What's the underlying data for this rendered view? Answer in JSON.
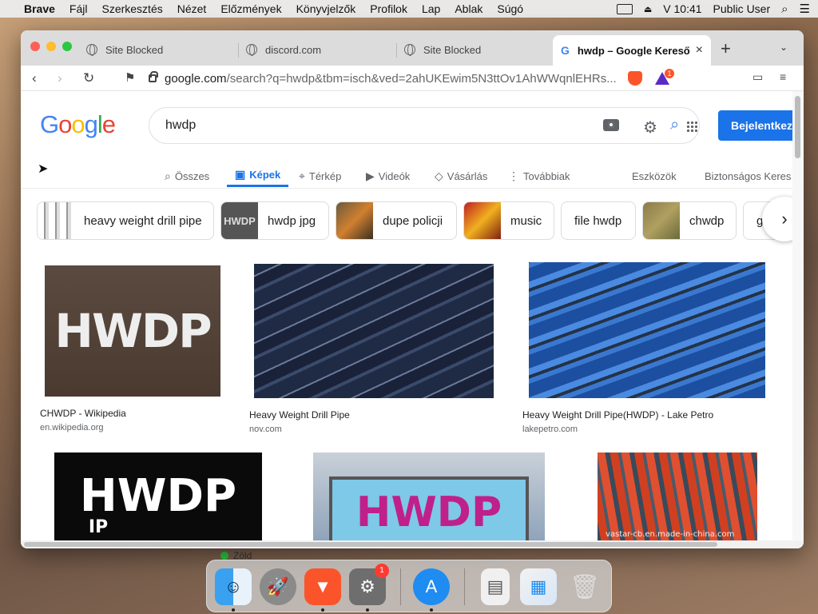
{
  "menubar": {
    "app": "Brave",
    "items": [
      "Fájl",
      "Szerkesztés",
      "Nézet",
      "Előzmények",
      "Könyvjelzők",
      "Profilok",
      "Lap",
      "Ablak",
      "Súgó"
    ],
    "time": "V 10:41",
    "user": "Public User"
  },
  "tabs": [
    {
      "label": "Site Blocked"
    },
    {
      "label": "discord.com"
    },
    {
      "label": "Site Blocked"
    },
    {
      "label": "hwdp – Google Kereső"
    }
  ],
  "address": {
    "host": "google.com",
    "path": "/search?q=hwdp&tbm=isch&ved=2ahUKEwim5N3ttOv1AhWWqnlEHRs..."
  },
  "brave_badge": "1",
  "google": {
    "query": "hwdp",
    "signin": "Bejelentkez",
    "nav": [
      "Összes",
      "Képek",
      "Térkép",
      "Videók",
      "Vásárlás",
      "Továbbiak"
    ],
    "tools": "Eszközök",
    "safe": "Biztonságos Keres"
  },
  "chips": [
    "heavy weight drill pipe",
    "hwdp jpg",
    "dupe policji",
    "music",
    "file hwdp",
    "chwdp",
    "g"
  ],
  "results": [
    {
      "title": "CHWDP - Wikipedia",
      "source": "en.wikipedia.org",
      "text": "HWDP"
    },
    {
      "title": "Heavy Weight Drill Pipe",
      "source": "nov.com"
    },
    {
      "title": "Heavy Weight Drill Pipe(HWDP) - Lake Petro",
      "source": "lakepetro.com"
    },
    {
      "text": "HWDP",
      "subtext": "IP"
    },
    {
      "text": "HWDP"
    },
    {
      "watermark": "vastar-cb.en.made-in-china.com"
    }
  ],
  "behind_window_label": "Zöld",
  "dock": {
    "settings_badge": "1"
  }
}
